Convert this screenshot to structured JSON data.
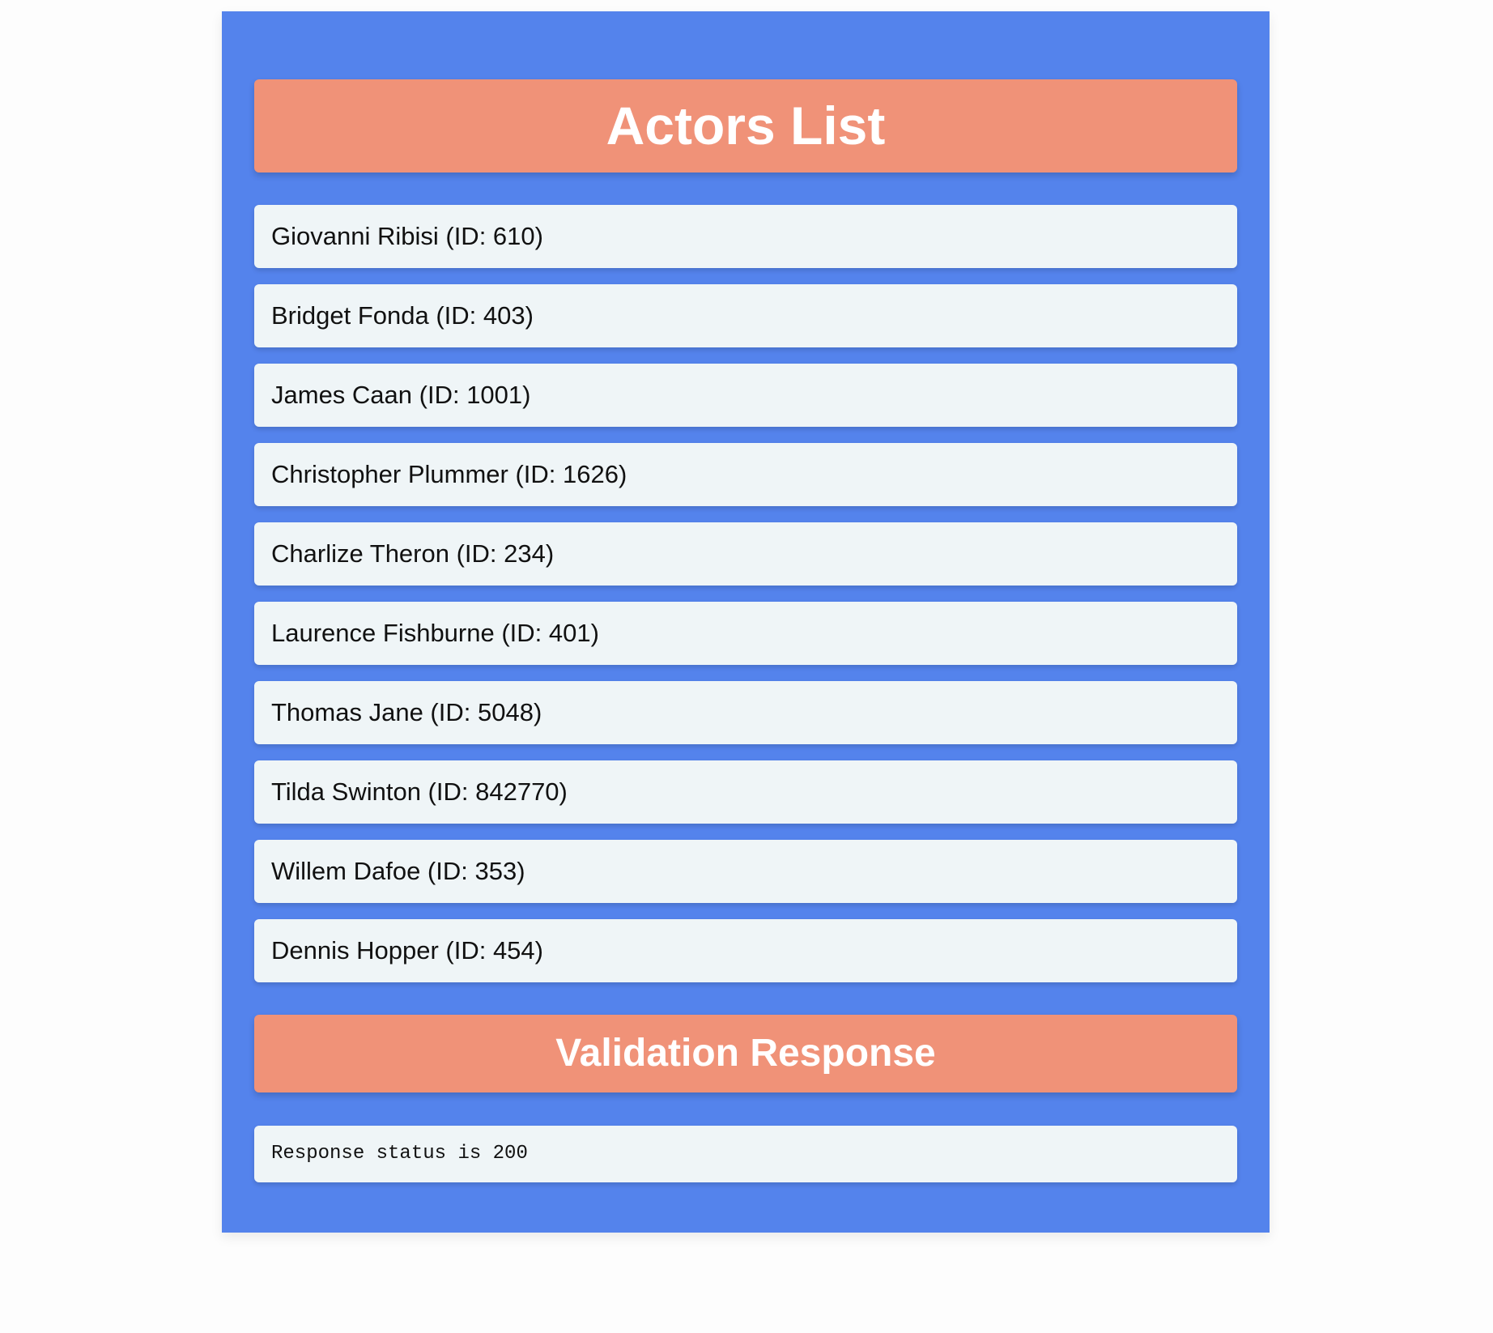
{
  "title": "Actors List",
  "actors": [
    {
      "label": "Giovanni Ribisi (ID: 610)"
    },
    {
      "label": "Bridget Fonda (ID: 403)"
    },
    {
      "label": "James Caan (ID: 1001)"
    },
    {
      "label": "Christopher Plummer (ID: 1626)"
    },
    {
      "label": "Charlize Theron (ID: 234)"
    },
    {
      "label": "Laurence Fishburne (ID: 401)"
    },
    {
      "label": "Thomas Jane (ID: 5048)"
    },
    {
      "label": "Tilda Swinton (ID: 842770)"
    },
    {
      "label": "Willem Dafoe (ID: 353)"
    },
    {
      "label": "Dennis Hopper (ID: 454)"
    }
  ],
  "validation": {
    "heading": "Validation Response",
    "message": "Response status is 200"
  },
  "colors": {
    "panel_background": "#5483ec",
    "header_background": "#f09278",
    "item_background": "#eff5f7",
    "header_text": "#ffffff"
  }
}
